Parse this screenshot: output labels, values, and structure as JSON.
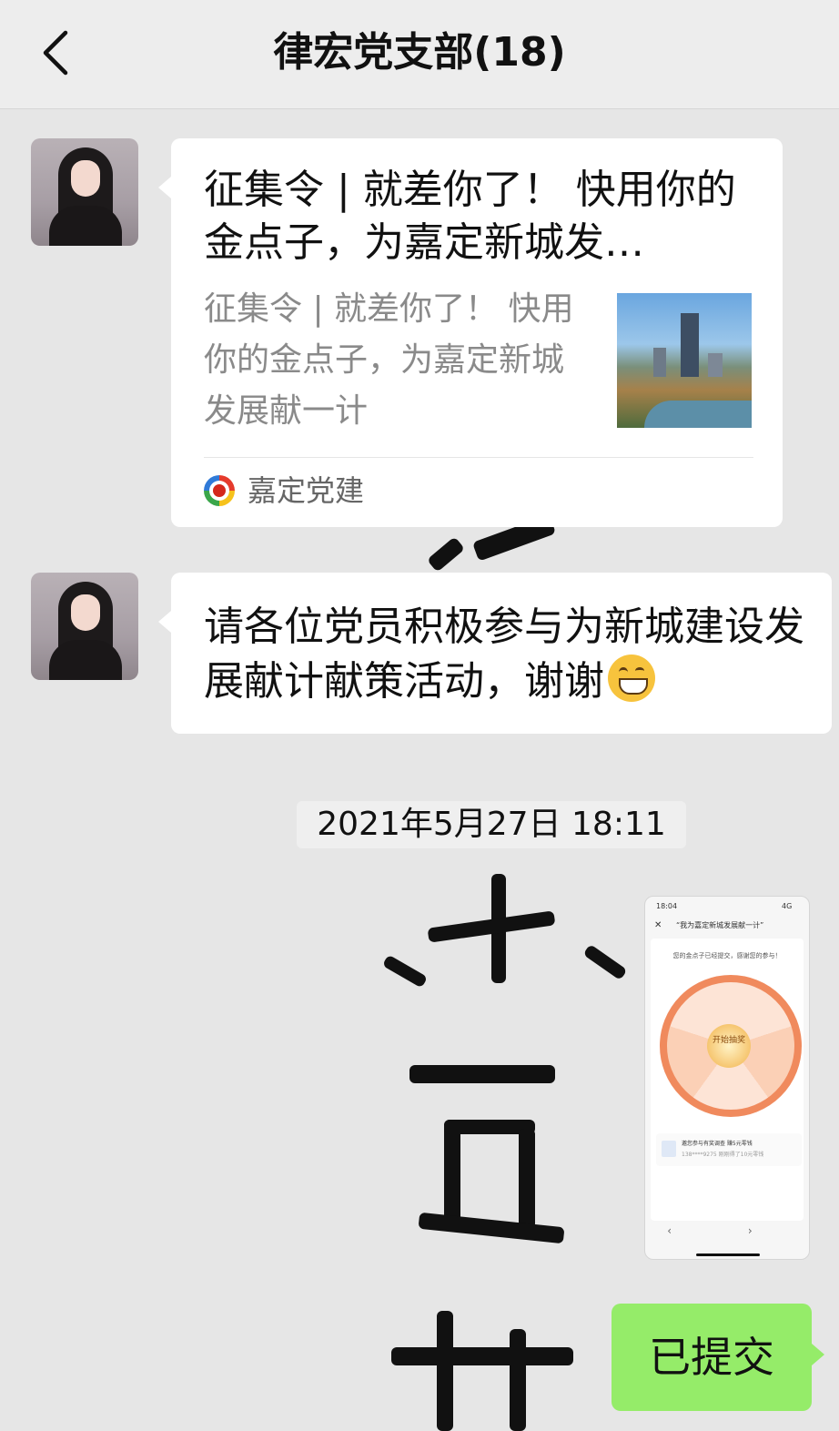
{
  "header": {
    "back_icon": "chevron-left-icon",
    "title": "律宏党支部(18)"
  },
  "messages": [
    {
      "type": "article-card",
      "title": "征集令 | 就差你了！ 快用你的金点子，为嘉定新城发…",
      "description": "征集令 | 就差你了！ 快用你的金点子，为嘉定新城发展献一计",
      "source": "嘉定党建"
    },
    {
      "type": "text",
      "text": "请各位党员积极参与为新城建设发展献计献策活动，谢谢",
      "emoji": "grin-emoji"
    }
  ],
  "timestamp": "2021年5月27日 18:11",
  "screenshot_image": {
    "status_time": "18:04",
    "status_signal": "4G",
    "page_title": "“我为嘉定新城发展献一计”",
    "message": "您的金点子已经提交，感谢您的参与！",
    "wheel_center": "开始抽奖",
    "survey_title": "邀您参与有奖调查 赚5元零钱",
    "survey_sub": "138****9275 刚刚得了10元零钱",
    "nav": "‹ ›"
  },
  "sent_message": "已提交",
  "colors": {
    "background": "#e6e6e6",
    "bubble_received": "#ffffff",
    "bubble_sent": "#95ec69"
  }
}
